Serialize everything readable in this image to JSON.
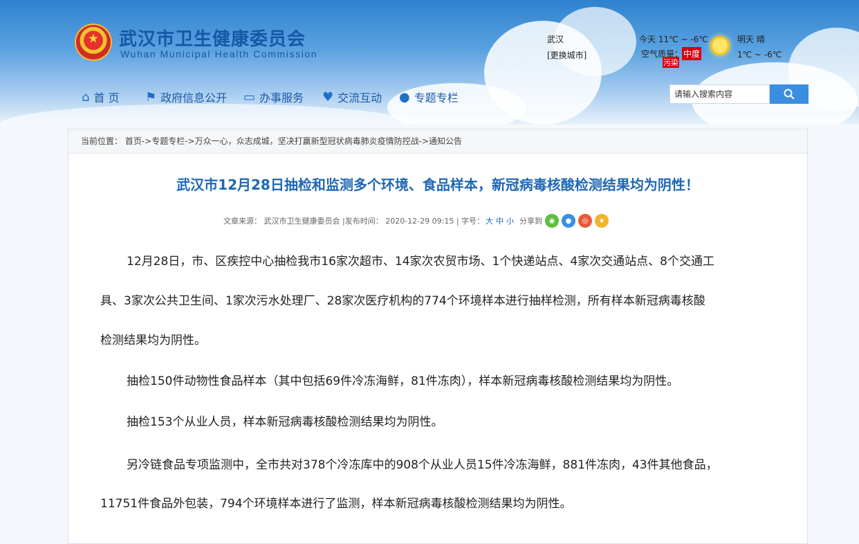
{
  "site": {
    "title_cn": "武汉市卫生健康委员会",
    "title_en": "Wuhan Municipal Health Commission",
    "logo_icon": "national-emblem-icon"
  },
  "weather": {
    "city": "武汉",
    "change_city": "[更换城市]",
    "today": "今天  11℃ ~ -6℃",
    "air_label": "空气质量：",
    "air_level": "中度",
    "air_level2": "污染",
    "tomorrow": "明天  晴",
    "tomorrow_temp": "1℃ ~ -6℃"
  },
  "nav": {
    "home": "首 页",
    "gov_info": "政府信息公开",
    "services": "办事服务",
    "interaction": "交流互动",
    "topics": "专题专栏"
  },
  "search": {
    "placeholder": "请输入搜索内容"
  },
  "breadcrumb": "当前位置： 首页->专题专栏->万众一心，众志成城，坚决打赢新型冠状病毒肺炎疫情防控战->通知公告",
  "article": {
    "title": "武汉市12月28日抽检和监测多个环境、食品样本，新冠病毒核酸检测结果均为阴性！",
    "source": "文章来源： 武汉市卫生健康委员会  |发布时间： 2020-12-29 09:15  |  字号：",
    "size_large": "大",
    "size_mid": "中",
    "size_small": "小",
    "share_label": "分享到",
    "p1_line1": "12月28日，市、区疾控中心抽检我市16家次超市、14家次农贸市场、1个快递站点、4家次交通站点、8个交通工",
    "p1_line2": "具、3家次公共卫生间、1家次污水处理厂、28家次医疗机构的774个环境样本进行抽样检测，所有样本新冠病毒核酸",
    "p1_line3": "检测结果均为阴性。",
    "p2": "抽检150件动物性食品样本（其中包括69件冷冻海鲜，81件冻肉），样本新冠病毒核酸检测结果均为阴性。",
    "p3": "抽检153个从业人员，样本新冠病毒核酸检测结果均为阴性。",
    "p4_line1": "另冷链食品专项监测中，全市共对378个冷冻库中的908个从业人员15件冷冻海鲜，881件冻肉，43件其他食品，",
    "p4_line2": "11751件食品外包装，794个环境样本进行了监测，样本新冠病毒核酸检测结果均为阴性。"
  }
}
